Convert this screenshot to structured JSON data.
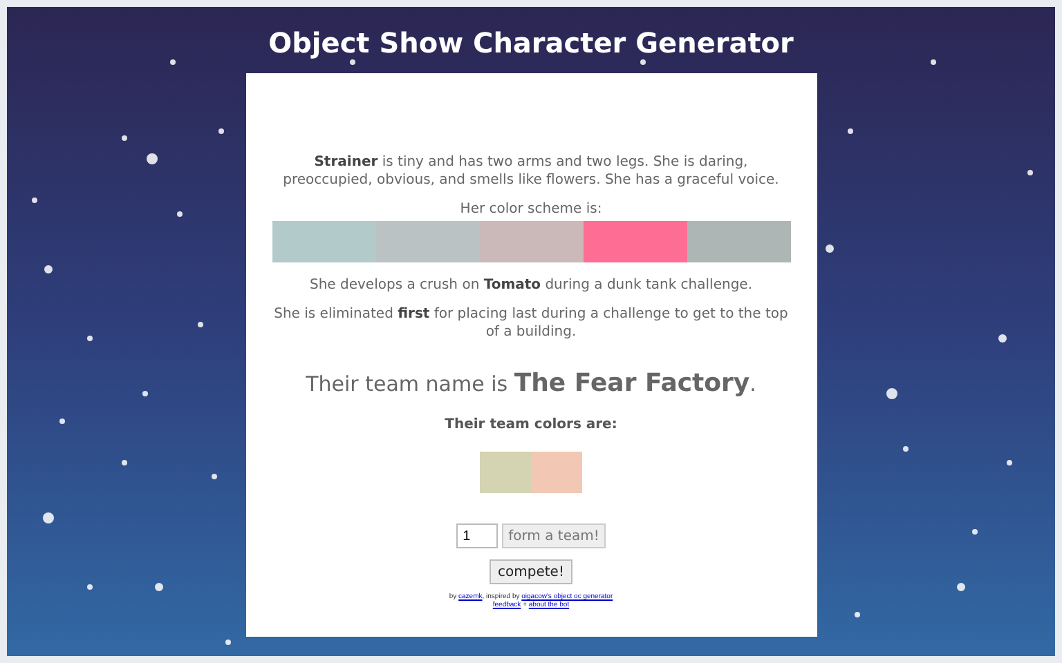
{
  "title": "Object Show Character Generator",
  "description": "**Strainer** is tiny and has two arms and two legs. She is daring, preoccupied, obvious, and smells like flowers. She has a graceful voice.",
  "scheme_label": "Her color scheme is:",
  "character_colors": [
    {
      "color": "#b3cacb"
    },
    {
      "color": "#bbc2c4"
    },
    {
      "color": "#cbb9b9"
    },
    {
      "color": "#fd6d94"
    },
    {
      "color": "#adb6b4"
    }
  ],
  "crush": "She develops a crush on **Tomato** during a dunk tank challenge.",
  "elimination": "She is eliminated **first** for placing last during a challenge to get to the top of a building.",
  "team_name_prefix": "Their team name is",
  "team_name": "The Fear Factory",
  "team_name_suffix": ".",
  "team_colors_label": "Their team colors are:",
  "team_colors": [
    {
      "color": "#d4d3b2"
    },
    {
      "color": "#f2c8b4"
    }
  ],
  "team_count": {
    "value": "1"
  },
  "form_button": "form a team!",
  "compete_button": "compete!",
  "footer": {
    "by": "by",
    "author_link": "cazemk",
    "inspired": ", inspired by",
    "source_link": "oigacow's object oc generator",
    "links": [
      {
        "text": "feedback"
      },
      {
        "text": "about the bot"
      }
    ],
    "separator": "+"
  }
}
